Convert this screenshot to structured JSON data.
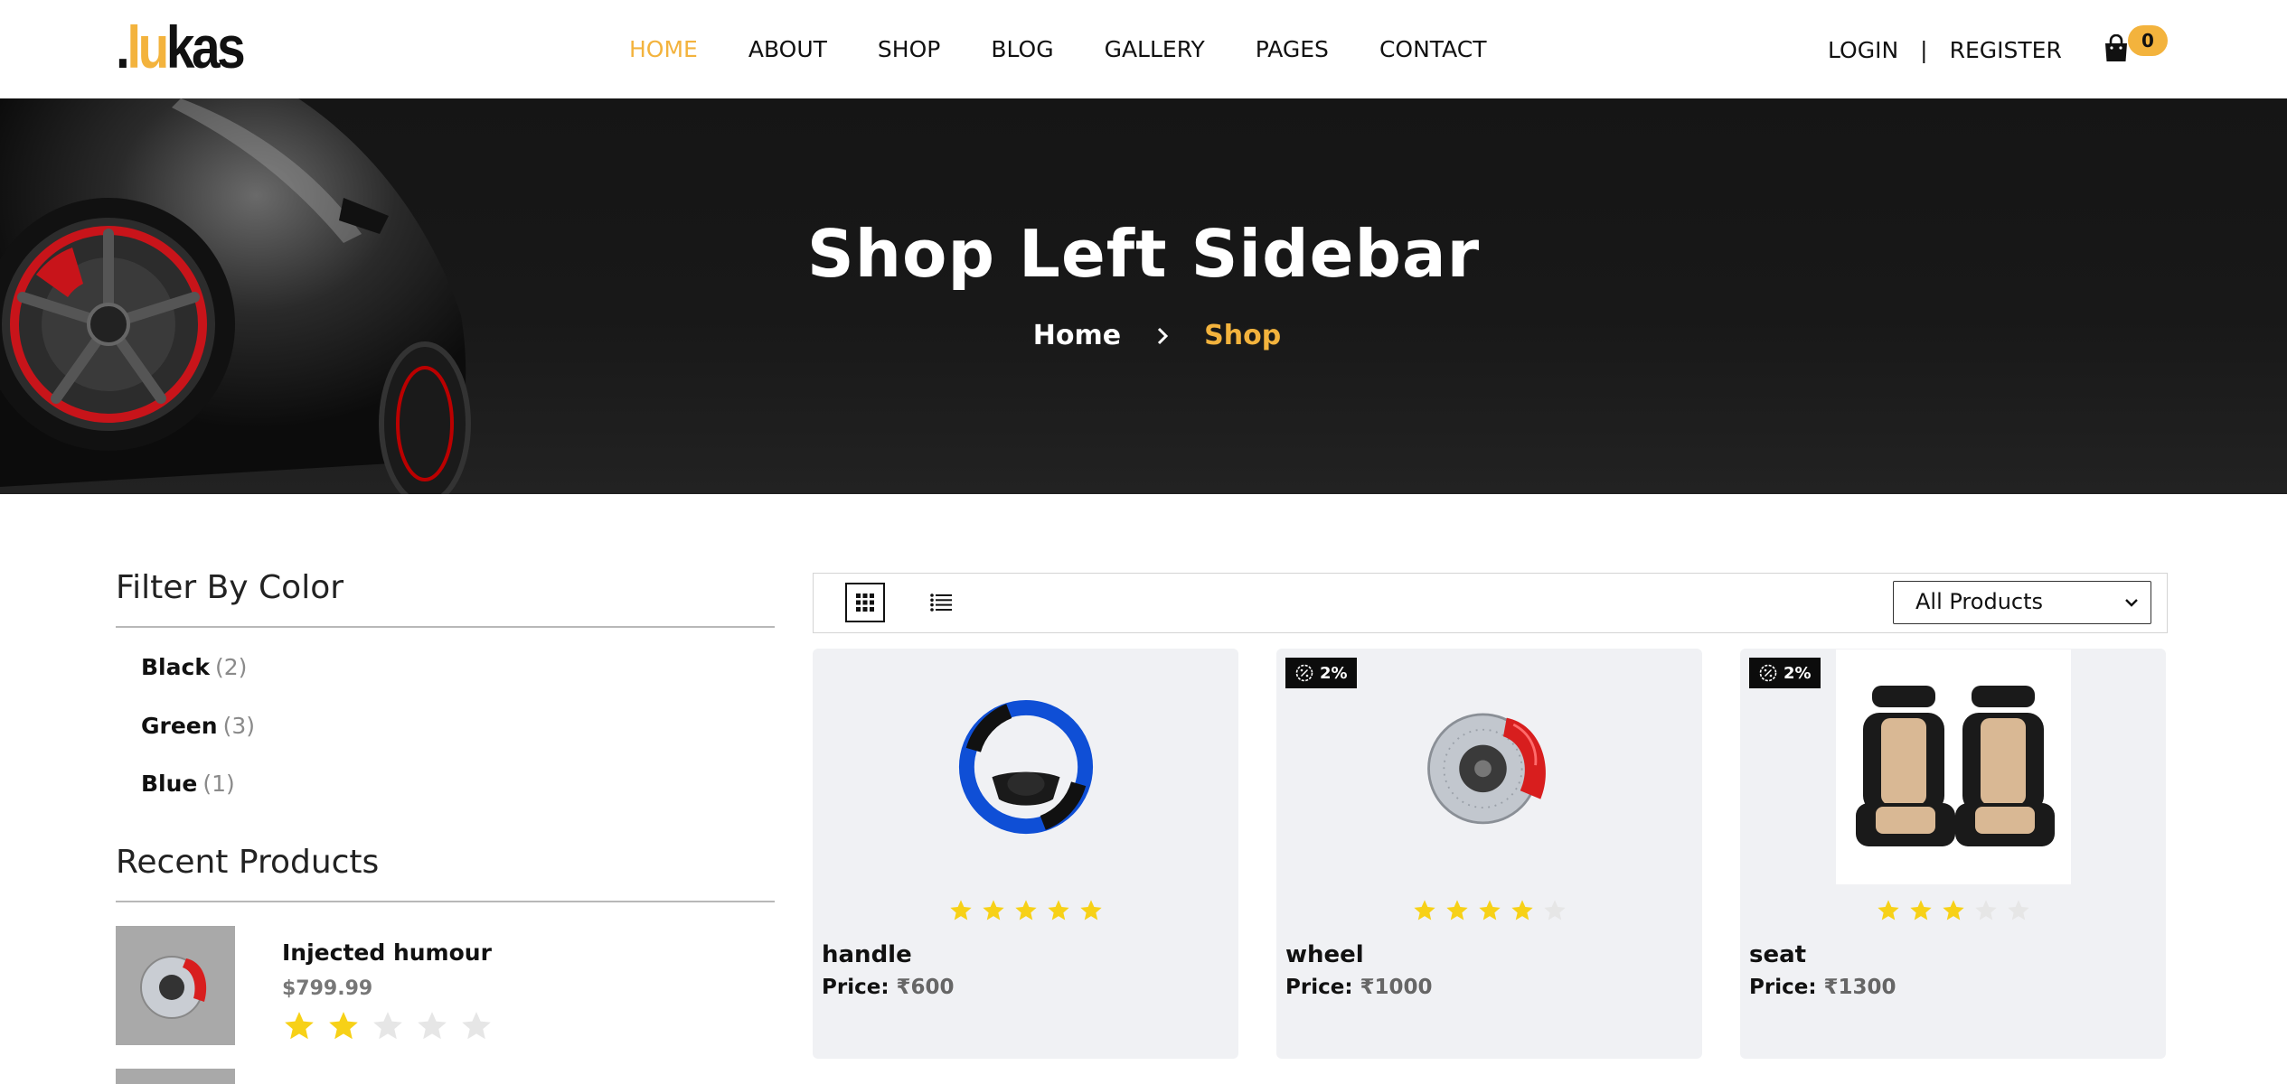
{
  "header": {
    "logo": {
      "dot": ".",
      "accent": "lu",
      "rest": "kas"
    },
    "nav": [
      "HOME",
      "ABOUT",
      "SHOP",
      "BLOG",
      "GALLERY",
      "PAGES",
      "CONTACT"
    ],
    "active_nav": "HOME",
    "login": "LOGIN",
    "separator": "|",
    "register": "REGISTER",
    "cart_count": "0",
    "cart_icon": "shopping-bag-icon"
  },
  "hero": {
    "title": "Shop Left Sidebar",
    "breadcrumb": {
      "home": "Home",
      "current": "Shop"
    }
  },
  "sidebar": {
    "filter_heading": "Filter By Color",
    "colors": [
      {
        "name": "Black",
        "count": "(2)"
      },
      {
        "name": "Green",
        "count": "(3)"
      },
      {
        "name": "Blue",
        "count": "(1)"
      }
    ],
    "recent_heading": "Recent Products",
    "recent": [
      {
        "name": "Injected humour",
        "price": "$799.99",
        "rating": 2,
        "max": 5
      }
    ]
  },
  "toolbar": {
    "grid_icon": "grid-view-icon",
    "list_icon": "list-view-icon",
    "sort_value": "All Products"
  },
  "products": [
    {
      "name": "handle",
      "price_label": "Price:",
      "price": "₹600",
      "rating": 5,
      "badge": ""
    },
    {
      "name": "wheel",
      "price_label": "Price:",
      "price": "₹1000",
      "rating": 4,
      "badge": "2%"
    },
    {
      "name": "seat",
      "price_label": "Price:",
      "price": "₹1300",
      "rating": 3,
      "badge": "2%"
    }
  ],
  "colors": {
    "accent": "#f3b33d",
    "star": "#f7d117",
    "star_empty": "#e6e6e6",
    "hero_bg": "#171717",
    "card_bg": "#f0f1f4"
  }
}
